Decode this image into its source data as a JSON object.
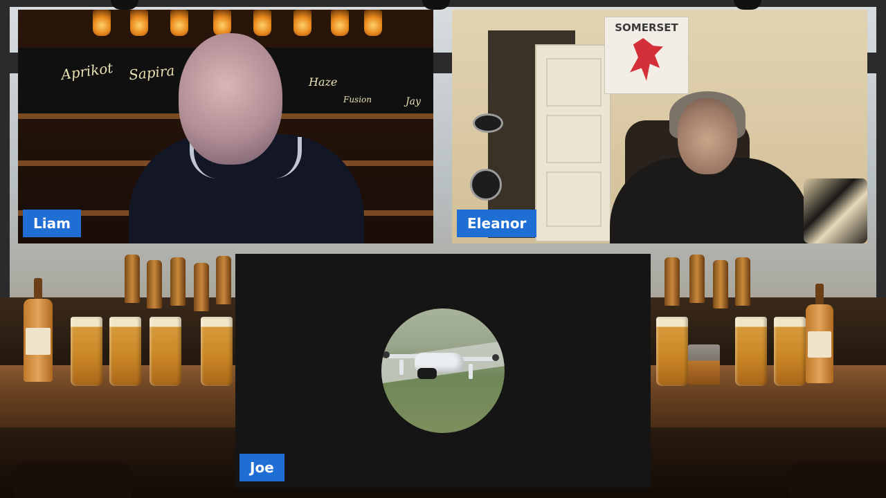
{
  "participants": [
    {
      "id": "liam",
      "name": "Liam"
    },
    {
      "id": "eleanor",
      "name": "Eleanor"
    },
    {
      "id": "joe",
      "name": "Joe"
    }
  ],
  "eleanor_room": {
    "flag_text": "SOMERSET"
  },
  "liam_background": {
    "chalkboard_text": [
      "Aprikot",
      "Sapira",
      "Haze",
      "Fusion",
      "Jay"
    ]
  },
  "colors": {
    "name_tag_bg": "#1f6ed4",
    "name_tag_text": "#ffffff",
    "camera_off_bg": "#151515"
  },
  "icons": {
    "joe_avatar": "drone-avatar-icon"
  }
}
